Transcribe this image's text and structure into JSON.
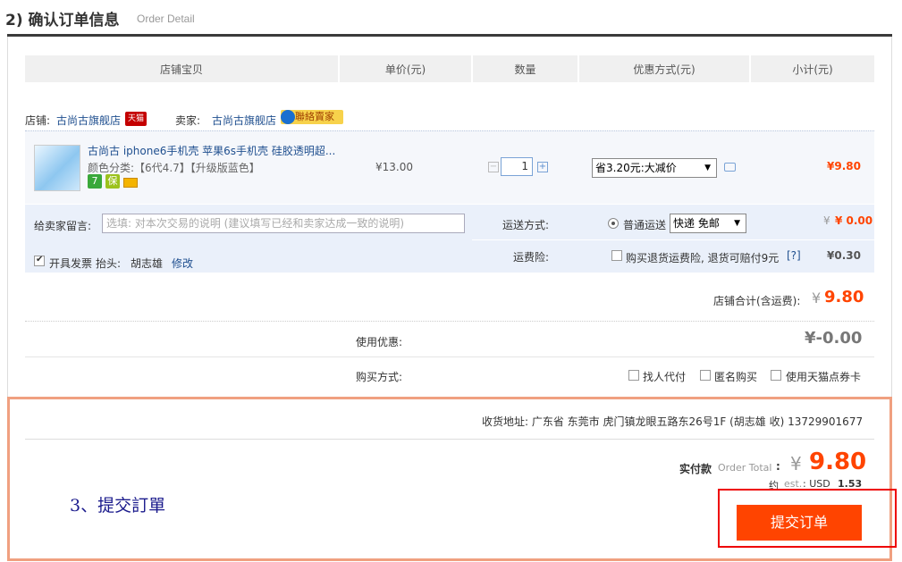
{
  "header": {
    "title": "2) 确认订单信息",
    "subtitle": "Order Detail"
  },
  "columns": [
    "店铺宝贝",
    "单价(元)",
    "数量",
    "优惠方式(元)",
    "小计(元)"
  ],
  "shop": {
    "shop_label": "店铺:",
    "shop_name": "古尚古旗舰店",
    "tmall_badge": "天猫",
    "seller_label": "卖家:",
    "seller_name": "古尚古旗舰店",
    "wangwang_label": "聯絡賣家"
  },
  "item": {
    "title": "古尚古 iphone6手机壳 苹果6s手机壳 硅胶透明超...",
    "sku": "颜色分类:【6代4.7】【升级版蓝色】",
    "unit_price": "¥13.00",
    "quantity": "1",
    "discount_option": "省3.20元:大减价",
    "subtotal": "¥9.80",
    "badges": [
      "7",
      "保",
      "card"
    ]
  },
  "message": {
    "label": "给卖家留言:",
    "placeholder": "选填: 对本次交易的说明 (建议填写已经和卖家达成一致的说明)"
  },
  "invoice": {
    "label": "开具发票",
    "title_label": "抬头:",
    "title_value": "胡志雄",
    "edit": "修改"
  },
  "shipping": {
    "label": "运送方式:",
    "option": "普通运送",
    "select": "快递 免邮",
    "price": "¥ 0.00"
  },
  "insurance": {
    "label": "运费险:",
    "text": "购买退货运费险, 退货可赔付9元",
    "help": "[?]",
    "price": "¥0.30"
  },
  "shop_total": {
    "label": "店铺合计(含运费):",
    "currency": "¥",
    "value": "9.80"
  },
  "coupon": {
    "label": "使用优惠:",
    "value": "¥-0.00"
  },
  "purchase_method": {
    "label": "购买方式:",
    "options": [
      "找人代付",
      "匿名购买",
      "使用天猫点券卡"
    ]
  },
  "address": {
    "text": "收货地址: 广东省 东莞市 虎门镇龙眼五路东26号1F (胡志雄 收) 13729901677"
  },
  "total": {
    "label": "实付款",
    "label_en": "Order Total",
    "colon": ":",
    "currency": "¥",
    "value": "9.80",
    "approx": "约",
    "est": "est.",
    "usd_label": ": USD",
    "usd_value": "1.53"
  },
  "annotation": "3、提交訂單",
  "submit_label": "提交订单",
  "colors": {
    "accent": "#ff4400",
    "link": "#1f4f8f",
    "header_bar": "#3a3a3a",
    "highlight_box": "#f0a080",
    "annotation_box": "#ee0000",
    "annotation_text": "#1a1a8c"
  }
}
